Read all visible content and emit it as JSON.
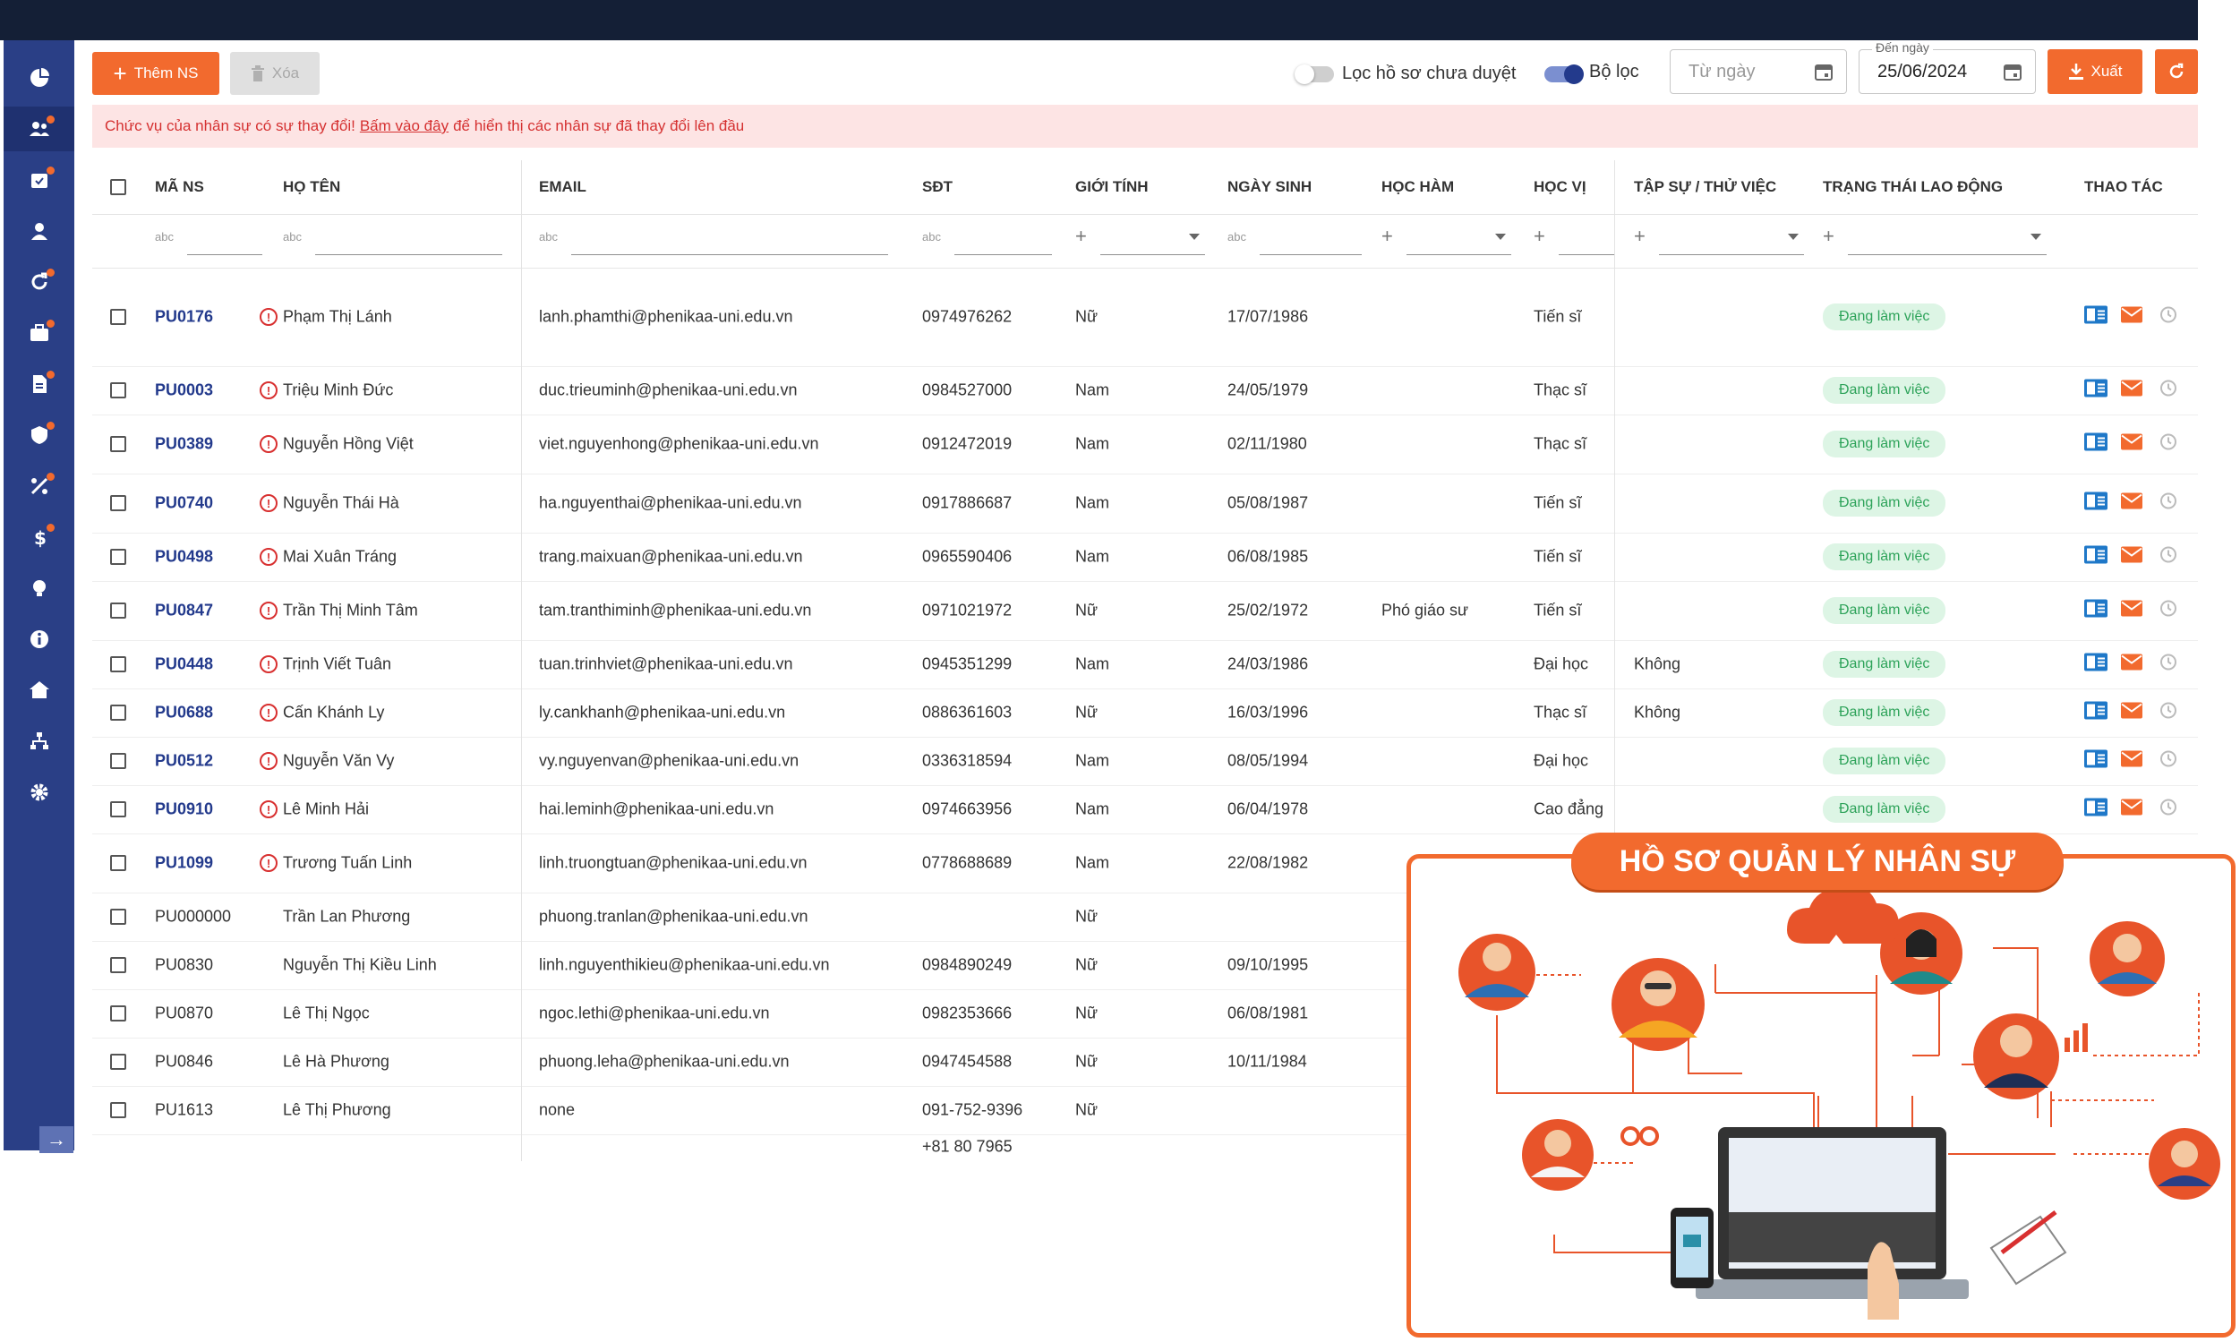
{
  "toolbar": {
    "add_label": "Thêm NS",
    "delete_label": "Xóa",
    "pending_toggle_label": "Lọc hồ sơ chưa duyệt",
    "filter_toggle_label": "Bộ lọc",
    "from_date_placeholder": "Từ ngày",
    "to_date_legend": "Đến ngày",
    "to_date_value": "25/06/2024",
    "export_label": "Xuất"
  },
  "alert": {
    "prefix": "Chức vụ của nhân sự có sự thay đổi!",
    "link": "Bấm vào đây",
    "suffix": "để hiển thị các nhân sự đã thay đổi lên đầu"
  },
  "columns": [
    "MÃ NS",
    "HỌ TÊN",
    "EMAIL",
    "SĐT",
    "GIỚI TÍNH",
    "NGÀY SINH",
    "HỌC HÀM",
    "HỌC VỊ",
    "TẬP SỰ / THỬ VIỆC",
    "TRẠNG THÁI LAO ĐỘNG",
    "THAO TÁC"
  ],
  "rows": [
    {
      "code": "PU0176",
      "name": "Phạm Thị Lánh",
      "email": "lanh.phamthi@phenikaa-uni.edu.vn",
      "phone": "0974976262",
      "gender": "Nữ",
      "dob": "17/07/1986",
      "rank": "",
      "degree": "Tiến sĩ",
      "probation": "",
      "status": "Đang làm việc"
    },
    {
      "code": "PU0003",
      "name": "Triệu Minh Đức",
      "email": "duc.trieuminh@phenikaa-uni.edu.vn",
      "phone": "0984527000",
      "gender": "Nam",
      "dob": "24/05/1979",
      "rank": "",
      "degree": "Thạc sĩ",
      "probation": "",
      "status": "Đang làm việc"
    },
    {
      "code": "PU0389",
      "name": "Nguyễn Hồng Việt",
      "email": "viet.nguyenhong@phenikaa-uni.edu.vn",
      "phone": "0912472019",
      "gender": "Nam",
      "dob": "02/11/1980",
      "rank": "",
      "degree": "Thạc sĩ",
      "probation": "",
      "status": "Đang làm việc"
    },
    {
      "code": "PU0740",
      "name": "Nguyễn Thái Hà",
      "email": "ha.nguyenthai@phenikaa-uni.edu.vn",
      "phone": "0917886687",
      "gender": "Nam",
      "dob": "05/08/1987",
      "rank": "",
      "degree": "Tiến sĩ",
      "probation": "",
      "status": "Đang làm việc"
    },
    {
      "code": "PU0498",
      "name": "Mai Xuân Tráng",
      "email": "trang.maixuan@phenikaa-uni.edu.vn",
      "phone": "0965590406",
      "gender": "Nam",
      "dob": "06/08/1985",
      "rank": "",
      "degree": "Tiến sĩ",
      "probation": "",
      "status": "Đang làm việc"
    },
    {
      "code": "PU0847",
      "name": "Trần Thị Minh Tâm",
      "email": "tam.tranthiminh@phenikaa-uni.edu.vn",
      "phone": "0971021972",
      "gender": "Nữ",
      "dob": "25/02/1972",
      "rank": "Phó giáo sư",
      "degree": "Tiến sĩ",
      "probation": "",
      "status": "Đang làm việc"
    },
    {
      "code": "PU0448",
      "name": "Trịnh Viết Tuân",
      "email": "tuan.trinhviet@phenikaa-uni.edu.vn",
      "phone": "0945351299",
      "gender": "Nam",
      "dob": "24/03/1986",
      "rank": "",
      "degree": "Đại học",
      "probation": "Không",
      "status": "Đang làm việc"
    },
    {
      "code": "PU0688",
      "name": "Cấn Khánh Ly",
      "email": "ly.cankhanh@phenikaa-uni.edu.vn",
      "phone": "0886361603",
      "gender": "Nữ",
      "dob": "16/03/1996",
      "rank": "",
      "degree": "Thạc sĩ",
      "probation": "Không",
      "status": "Đang làm việc"
    },
    {
      "code": "PU0512",
      "name": "Nguyễn Văn Vy",
      "email": "vy.nguyenvan@phenikaa-uni.edu.vn",
      "phone": "0336318594",
      "gender": "Nam",
      "dob": "08/05/1994",
      "rank": "",
      "degree": "Đại học",
      "probation": "",
      "status": "Đang làm việc"
    },
    {
      "code": "PU0910",
      "name": "Lê Minh Hải",
      "email": "hai.leminh@phenikaa-uni.edu.vn",
      "phone": "0974663956",
      "gender": "Nam",
      "dob": "06/04/1978",
      "rank": "",
      "degree": "Cao đẳng",
      "probation": "",
      "status": "Đang làm việc"
    },
    {
      "code": "PU1099",
      "name": "Trương Tuấn Linh",
      "email": "linh.truongtuan@phenikaa-uni.edu.vn",
      "phone": "0778688689",
      "gender": "Nam",
      "dob": "22/08/1982",
      "rank": "",
      "degree": "",
      "probation": "",
      "status": ""
    },
    {
      "code": "PU000000",
      "name": "Trần Lan Phương",
      "email": "phuong.tranlan@phenikaa-uni.edu.vn",
      "phone": "",
      "gender": "Nữ",
      "dob": "",
      "rank": "",
      "degree": "",
      "probation": "",
      "status": ""
    },
    {
      "code": "PU0830",
      "name": "Nguyễn Thị Kiều Linh",
      "email": "linh.nguyenthikieu@phenikaa-uni.edu.vn",
      "phone": "0984890249",
      "gender": "Nữ",
      "dob": "09/10/1995",
      "rank": "",
      "degree": "",
      "probation": "",
      "status": ""
    },
    {
      "code": "PU0870",
      "name": "Lê Thị Ngọc",
      "email": "ngoc.lethi@phenikaa-uni.edu.vn",
      "phone": "0982353666",
      "gender": "Nữ",
      "dob": "06/08/1981",
      "rank": "",
      "degree": "",
      "probation": "",
      "status": ""
    },
    {
      "code": "PU0846",
      "name": "Lê Hà Phương",
      "email": "phuong.leha@phenikaa-uni.edu.vn",
      "phone": "0947454588",
      "gender": "Nữ",
      "dob": "10/11/1984",
      "rank": "",
      "degree": "",
      "probation": "",
      "status": ""
    },
    {
      "code": "PU1613",
      "name": "Lê Thị Phương",
      "email": "none",
      "phone": "091-752-9396",
      "gender": "Nữ",
      "dob": "",
      "rank": "",
      "degree": "",
      "probation": "",
      "status": ""
    }
  ],
  "trailing_phone": "+81 80 7965",
  "promo": {
    "title": "HỒ SƠ QUẢN LÝ NHÂN SỰ"
  },
  "colors": {
    "primary": "#2a3f86",
    "accent": "#f26a2e",
    "topbar": "#141f36",
    "alert_bg": "#fde4e4",
    "success": "#2ea35a"
  },
  "sidebar_icons": [
    "dashboard-icon",
    "users-icon",
    "calendar-check-icon",
    "user-icon",
    "sync-icon",
    "briefcase-icon",
    "document-icon",
    "shield-icon",
    "percent-icon",
    "dollar-icon",
    "lightbulb-icon",
    "info-icon",
    "home-icon",
    "sitemap-icon",
    "settings-icon"
  ]
}
